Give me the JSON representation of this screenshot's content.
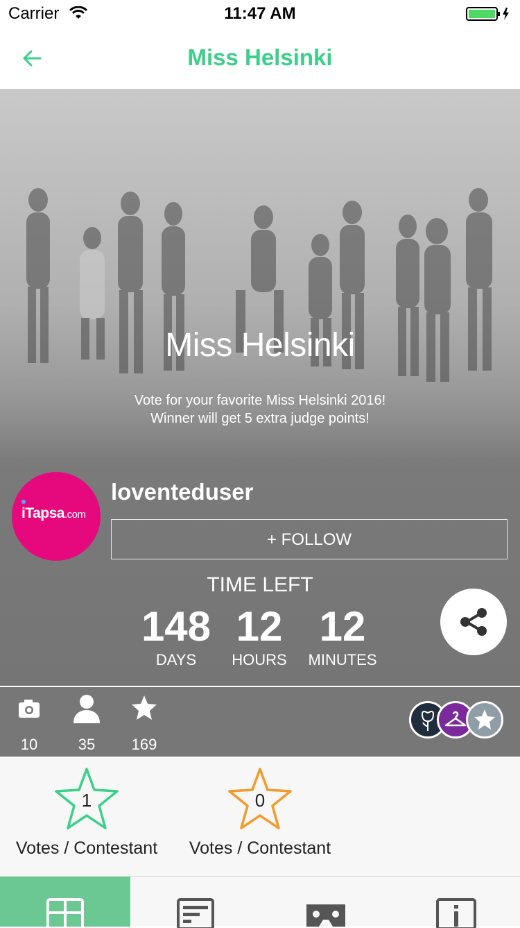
{
  "status_bar": {
    "carrier": "Carrier",
    "time": "11:47 AM"
  },
  "nav": {
    "title": "Miss Helsinki",
    "back_icon": "arrow-left-icon"
  },
  "hero": {
    "title": "Miss Helsinki",
    "description_line1": "Vote for your favorite Miss Helsinki 2016!",
    "description_line2": "Winner will get 5 extra judge points!"
  },
  "organizer": {
    "avatar_logo_text": "iTapsa",
    "avatar_logo_suffix": ".com",
    "username": "loventeduser",
    "follow_label": "+ FOLLOW"
  },
  "countdown": {
    "heading": "TIME LEFT",
    "days": "148",
    "days_label": "DAYS",
    "hours": "12",
    "hours_label": "HOURS",
    "minutes": "12",
    "minutes_label": "MINUTES"
  },
  "stats": {
    "photos": "10",
    "users": "35",
    "stars": "169"
  },
  "badges": [
    "rose-icon",
    "hanger-icon",
    "star-icon"
  ],
  "votes": [
    {
      "count": "1",
      "label": "Votes / Contestant",
      "color": "#3ccf8a"
    },
    {
      "count": "0",
      "label": "Votes / Contestant",
      "color": "#f39a2b"
    }
  ],
  "tabs": [
    "grid-icon",
    "list-icon",
    "vr-icon",
    "info-icon"
  ],
  "colors": {
    "accent": "#3ccf8a",
    "tab_active": "#6cc893",
    "avatar_bg": "#e6097e",
    "orange": "#f39a2b"
  }
}
